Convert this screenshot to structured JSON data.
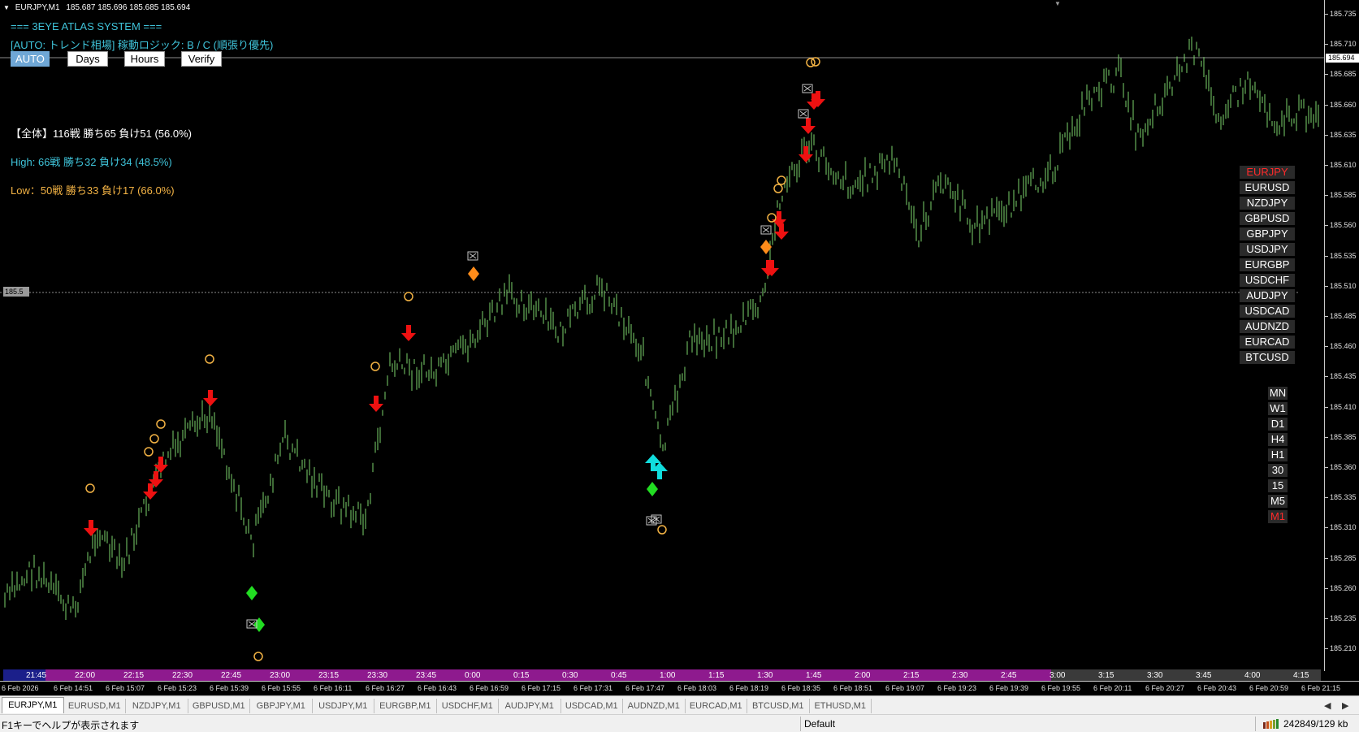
{
  "window": {
    "symbol_header": "EURJPY,M1",
    "ohlc": "185.687 185.696 185.685 185.694"
  },
  "overlay": {
    "system_title": "=== 3EYE ATLAS SYSTEM ===",
    "auto_status": "[AUTO: トレンド相場] 稼動ロジック: B / C (順張り優先)",
    "stats_total": "【全体】116戦 勝ち65 負け51 (56.0%)",
    "stats_high": "High: 66戦 勝ち32 負け34 (48.5%)",
    "stats_low": "Low：50戦 勝ち33 負け17 (66.0%)",
    "colors": {
      "cyan": "#3fc3d9",
      "orange": "#f2b244",
      "white": "#ffffff",
      "candle": "#7bd36b",
      "sell_arrow": "#ee1111",
      "buy_arrow": "#11dddd",
      "diamond_green": "#22dd22",
      "diamond_orange": "#ff8c1a"
    }
  },
  "mode_buttons": [
    {
      "label": "AUTO",
      "active": true
    },
    {
      "label": "Days",
      "active": false
    },
    {
      "label": "Hours",
      "active": false
    },
    {
      "label": "Verify",
      "active": false
    }
  ],
  "symbol_panel": [
    {
      "label": "EURJPY",
      "active": true
    },
    {
      "label": "EURUSD",
      "active": false
    },
    {
      "label": "NZDJPY",
      "active": false
    },
    {
      "label": "GBPUSD",
      "active": false
    },
    {
      "label": "GBPJPY",
      "active": false
    },
    {
      "label": "USDJPY",
      "active": false
    },
    {
      "label": "EURGBP",
      "active": false
    },
    {
      "label": "USDCHF",
      "active": false
    },
    {
      "label": "AUDJPY",
      "active": false
    },
    {
      "label": "USDCAD",
      "active": false
    },
    {
      "label": "AUDNZD",
      "active": false
    },
    {
      "label": "EURCAD",
      "active": false
    },
    {
      "label": "BTCUSD",
      "active": false
    }
  ],
  "timeframe_panel": [
    {
      "label": "MN",
      "active": false
    },
    {
      "label": "W1",
      "active": false
    },
    {
      "label": "D1",
      "active": false
    },
    {
      "label": "H4",
      "active": false
    },
    {
      "label": "H1",
      "active": false
    },
    {
      "label": "30",
      "active": false
    },
    {
      "label": "15",
      "active": false
    },
    {
      "label": "M5",
      "active": false
    },
    {
      "label": "M1",
      "active": true
    }
  ],
  "price_scale": {
    "ticks": [
      "185.735",
      "185.710",
      "185.685",
      "185.660",
      "185.635",
      "185.610",
      "185.585",
      "185.560",
      "185.535",
      "185.510",
      "185.485",
      "185.460",
      "185.435",
      "185.410",
      "185.385",
      "185.360",
      "185.335",
      "185.310",
      "185.285",
      "185.260",
      "185.235",
      "185.210"
    ],
    "current_price": "185.694",
    "hline_label": "185.5"
  },
  "session_labels": [
    "21:45",
    "22:00",
    "22:15",
    "22:30",
    "22:45",
    "23:00",
    "23:15",
    "23:30",
    "23:45",
    "0:00",
    "0:15",
    "0:30",
    "0:45",
    "1:00",
    "1:15",
    "1:30",
    "1:45",
    "2:00",
    "2:15",
    "2:30",
    "2:45",
    "3:00",
    "3:15",
    "3:30",
    "3:45",
    "4:00",
    "4:15"
  ],
  "time_axis": [
    "6 Feb 2026",
    "6 Feb 14:51",
    "6 Feb 15:07",
    "6 Feb 15:23",
    "6 Feb 15:39",
    "6 Feb 15:55",
    "6 Feb 16:11",
    "6 Feb 16:27",
    "6 Feb 16:43",
    "6 Feb 16:59",
    "6 Feb 17:15",
    "6 Feb 17:31",
    "6 Feb 17:47",
    "6 Feb 18:03",
    "6 Feb 18:19",
    "6 Feb 18:35",
    "6 Feb 18:51",
    "6 Feb 19:07",
    "6 Feb 19:23",
    "6 Feb 19:39",
    "6 Feb 19:55",
    "6 Feb 20:11",
    "6 Feb 20:27",
    "6 Feb 20:43",
    "6 Feb 20:59",
    "6 Feb 21:15"
  ],
  "tabs": [
    {
      "label": "EURJPY,M1",
      "active": true
    },
    {
      "label": "EURUSD,M1",
      "active": false
    },
    {
      "label": "NZDJPY,M1",
      "active": false
    },
    {
      "label": "GBPUSD,M1",
      "active": false
    },
    {
      "label": "GBPJPY,M1",
      "active": false
    },
    {
      "label": "USDJPY,M1",
      "active": false
    },
    {
      "label": "EURGBP,M1",
      "active": false
    },
    {
      "label": "USDCHF,M1",
      "active": false
    },
    {
      "label": "AUDJPY,M1",
      "active": false
    },
    {
      "label": "USDCAD,M1",
      "active": false
    },
    {
      "label": "AUDNZD,M1",
      "active": false
    },
    {
      "label": "EURCAD,M1",
      "active": false
    },
    {
      "label": "BTCUSD,M1",
      "active": false
    },
    {
      "label": "ETHUSD,M1",
      "active": false
    }
  ],
  "status": {
    "help": "F1キーでヘルプが表示されます",
    "profile": "Default",
    "traffic": "242849/129 kb"
  }
}
